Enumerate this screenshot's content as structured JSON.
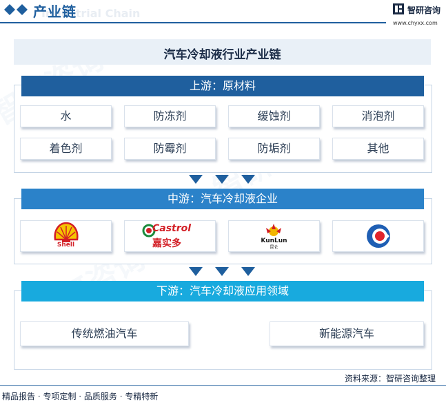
{
  "header": {
    "title": "产业链",
    "ghost_text": "Industrial Chain",
    "brand_name": "智研咨询",
    "brand_url": "www.chyxx.com"
  },
  "main_title": "汽车冷却液行业产业链",
  "upstream": {
    "title": "上游：原材料",
    "items": [
      "水",
      "防冻剂",
      "缓蚀剂",
      "消泡剂",
      "着色剂",
      "防霉剂",
      "防垢剂",
      "其他"
    ]
  },
  "midstream": {
    "title": "中游：汽车冷却液企业",
    "logos": [
      {
        "name": "shell-logo",
        "caption": "Shell"
      },
      {
        "name": "castrol-logo",
        "caption": "Castrol",
        "sub": "嘉实多"
      },
      {
        "name": "kunlun-logo",
        "caption": "KunLun",
        "sub": "昆仑"
      },
      {
        "name": "sinopec-logo",
        "caption": ""
      }
    ]
  },
  "downstream": {
    "title": "下游：汽车冷却液应用领域",
    "items": [
      "传统燃油汽车",
      "新能源汽车"
    ]
  },
  "footer": {
    "left": "精品报告 · 专项定制 · 品质服务 · 专精特新",
    "source": "资料来源：智研咨询整理"
  },
  "colors": {
    "upstream_head": "#1f5f9e",
    "midstream_head": "#2b82c9",
    "downstream_head": "#18aade",
    "arrow": "#1f5f9e"
  }
}
